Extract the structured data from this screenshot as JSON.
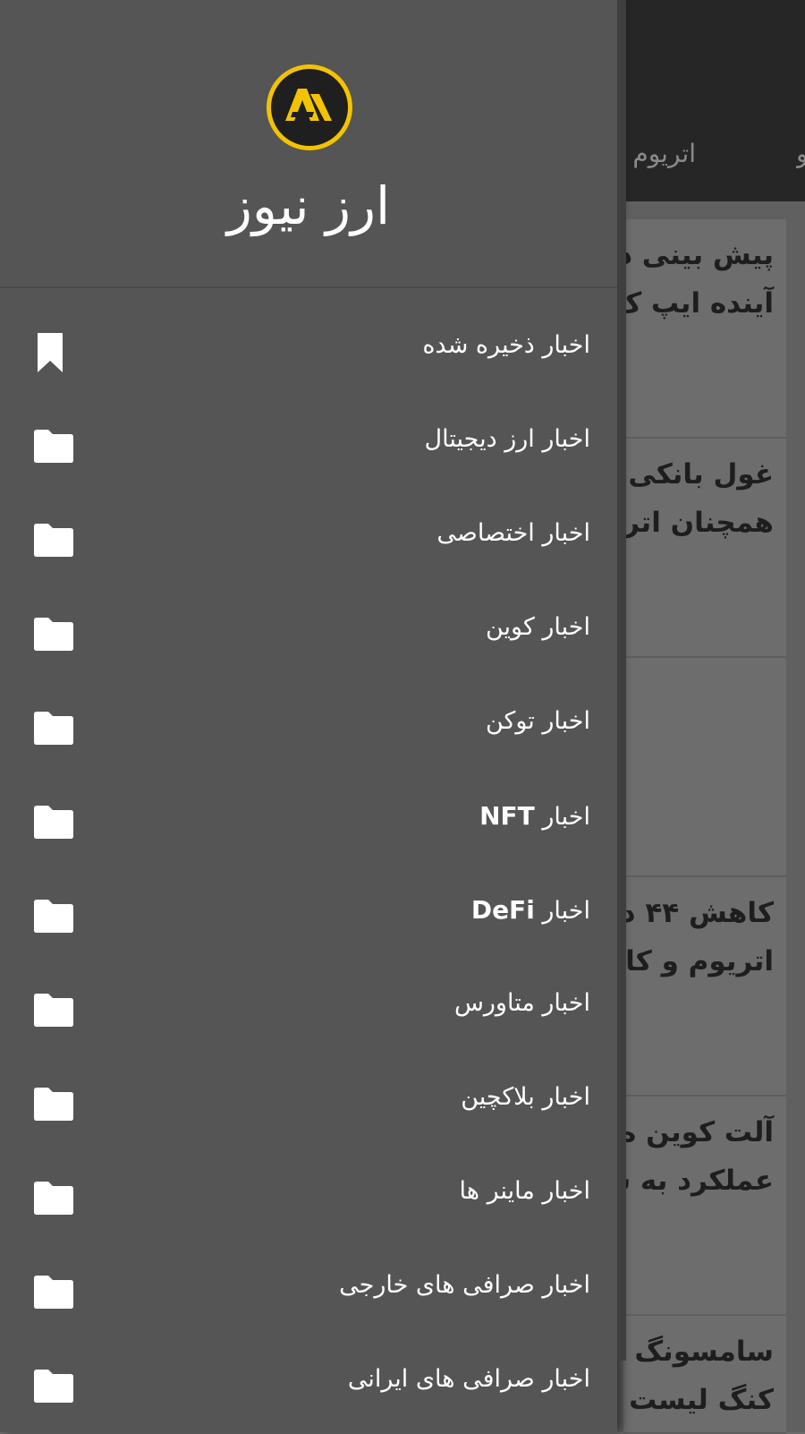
{
  "app": {
    "title": "ارز نیوز",
    "logo_text": "AV"
  },
  "background": {
    "tabs": [
      "اتریوم",
      "و"
    ],
    "cards": [
      {
        "line1": "پیش بینی د",
        "line2": "آینده ایپ ک"
      },
      {
        "line1": "غول بانکی",
        "line2": "همچنان اتری"
      },
      {
        "line1": "",
        "line2": ""
      },
      {
        "line1": "کاهش ۴۴ د",
        "line2": "اتریوم و کا"
      },
      {
        "line1": "آلت کوین ه",
        "line2": "عملکرد به ش"
      },
      {
        "line1": "سامسونگ ت",
        "line2": "کنگ لیست"
      }
    ]
  },
  "menu": {
    "items": [
      {
        "label": "اخبار ذخیره شده",
        "icon": "bookmark-icon"
      },
      {
        "label": "اخبار ارز دیجیتال",
        "icon": "folder-icon"
      },
      {
        "label": "اخبار اختصاصی",
        "icon": "folder-icon"
      },
      {
        "label": "اخبار کوین",
        "icon": "folder-icon"
      },
      {
        "label": "اخبار توکن",
        "icon": "folder-icon"
      },
      {
        "label": "اخبار",
        "latin": "NFT",
        "icon": "folder-icon"
      },
      {
        "label": "اخبار",
        "latin": "DeFi",
        "icon": "folder-icon"
      },
      {
        "label": "اخبار متاورس",
        "icon": "folder-icon"
      },
      {
        "label": "اخبار بلاکچین",
        "icon": "folder-icon"
      },
      {
        "label": "اخبار ماینر ها",
        "icon": "folder-icon"
      },
      {
        "label": "اخبار صرافی های خارجی",
        "icon": "folder-icon"
      },
      {
        "label": "اخبار صرافی های ایرانی",
        "icon": "folder-icon"
      }
    ]
  },
  "colors": {
    "drawer_bg": "#555555",
    "accent": "#f3c300",
    "header_bg": "#262626"
  }
}
